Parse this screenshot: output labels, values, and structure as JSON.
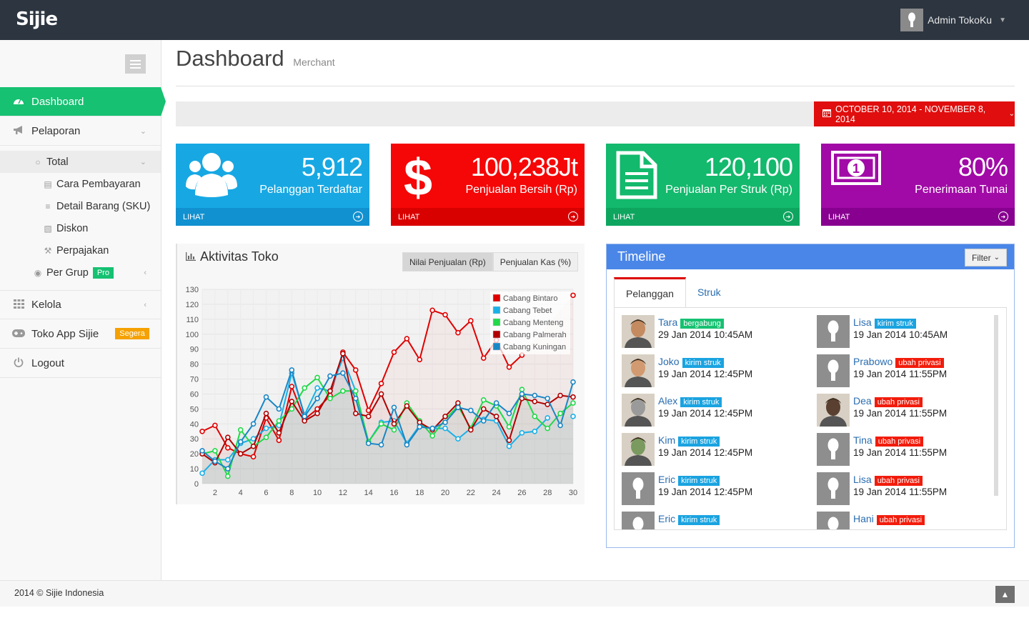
{
  "topbar": {
    "brand": "Sijie",
    "user_name": "Admin TokoKu"
  },
  "sidebar": {
    "items": [
      {
        "label": "Dashboard",
        "icon": "dashboard-icon"
      },
      {
        "label": "Pelaporan",
        "icon": "bullhorn-icon"
      },
      {
        "label": "Kelola",
        "icon": "grid-icon"
      },
      {
        "label": "Toko App Sijie",
        "icon": "gamepad-icon",
        "badge": "Segera"
      },
      {
        "label": "Logout",
        "icon": "power-icon"
      }
    ],
    "subitems": [
      {
        "label": "Total",
        "icon": "circle-icon"
      },
      {
        "label": "Cara Pembayaran",
        "icon": "credit-card-icon"
      },
      {
        "label": "Detail Barang (SKU)",
        "icon": "list-icon"
      },
      {
        "label": "Diskon",
        "icon": "gift-icon"
      },
      {
        "label": "Perpajakan",
        "icon": "gavel-icon"
      },
      {
        "label": "Per Grup",
        "icon": "map-marker-icon",
        "badge": "Pro"
      }
    ]
  },
  "page": {
    "title": "Dashboard",
    "subtitle": "Merchant"
  },
  "daterange": "OCTOBER 10, 2014 - NOVEMBER 8, 2014",
  "stats": [
    {
      "value": "5,912",
      "label": "Pelanggan Terdaftar",
      "link": "LIHAT",
      "color": "#17a8e3",
      "footer_color": "#1291d0"
    },
    {
      "value": "100,238Jt",
      "label": "Penjualan Bersih (Rp)",
      "link": "LIHAT",
      "color": "#f50707",
      "footer_color": "#d90000"
    },
    {
      "value": "120,100",
      "label": "Penjualan Per Struk (Rp)",
      "link": "LIHAT",
      "color": "#13b96c",
      "footer_color": "#0ea65f"
    },
    {
      "value": "80%",
      "label": "Penerimaan Tunai",
      "link": "LIHAT",
      "color": "#a10aa6",
      "footer_color": "#880090"
    }
  ],
  "chart_panel": {
    "title": "Aktivitas Toko",
    "segments": [
      "Nilai Penjualan (Rp)",
      "Penjualan Kas (%)"
    ]
  },
  "chart_data": {
    "type": "line",
    "x": [
      1,
      2,
      3,
      4,
      5,
      6,
      7,
      8,
      9,
      10,
      11,
      12,
      13,
      14,
      15,
      16,
      17,
      18,
      19,
      20,
      21,
      22,
      23,
      24,
      25,
      26,
      27,
      28,
      29,
      30
    ],
    "xticks": [
      2,
      4,
      6,
      8,
      10,
      12,
      14,
      16,
      18,
      20,
      22,
      24,
      26,
      28,
      30
    ],
    "ylim": [
      0,
      130
    ],
    "yticks": [
      0,
      10,
      20,
      30,
      40,
      50,
      60,
      70,
      80,
      90,
      100,
      110,
      120,
      130
    ],
    "legend_position": "top-right",
    "grid": true,
    "series": [
      {
        "name": "Cabang Bintaro",
        "color": "#e00000",
        "values": [
          35,
          39,
          24,
          20,
          18,
          44,
          29,
          65,
          43,
          50,
          59,
          88,
          76,
          49,
          67,
          88,
          97,
          83,
          116,
          113,
          101,
          109,
          84,
          96,
          78,
          86,
          null,
          null,
          null,
          126
        ]
      },
      {
        "name": "Cabang Tebet",
        "color": "#1ab0e8",
        "values": [
          7,
          16,
          16,
          27,
          30,
          37,
          39,
          74,
          46,
          64,
          62,
          84,
          62,
          28,
          41,
          42,
          27,
          39,
          37,
          37,
          30,
          37,
          43,
          42,
          25,
          34,
          35,
          44,
          null,
          45
        ]
      },
      {
        "name": "Cabang Menteng",
        "color": "#22d84a",
        "values": [
          20,
          22,
          5,
          36,
          25,
          31,
          42,
          50,
          64,
          71,
          57,
          62,
          62,
          28,
          40,
          36,
          54,
          42,
          32,
          43,
          52,
          37,
          56,
          52,
          38,
          63,
          45,
          37,
          47,
          54
        ]
      },
      {
        "name": "Cabang Palmerah",
        "color": "#b00000",
        "values": [
          20,
          14,
          31,
          20,
          25,
          47,
          34,
          55,
          42,
          47,
          62,
          87,
          47,
          45,
          60,
          40,
          52,
          41,
          36,
          45,
          54,
          36,
          50,
          45,
          29,
          57,
          55,
          53,
          59,
          58
        ]
      },
      {
        "name": "Cabang Kuningan",
        "color": "#1a86c4",
        "values": [
          22,
          15,
          10,
          28,
          40,
          58,
          50,
          76,
          45,
          57,
          72,
          74,
          57,
          27,
          26,
          51,
          26,
          38,
          37,
          41,
          51,
          49,
          42,
          54,
          47,
          60,
          59,
          57,
          39,
          68
        ]
      }
    ]
  },
  "timeline": {
    "title": "Timeline",
    "filter": "Filter",
    "tabs": [
      "Pelanggan",
      "Struk"
    ],
    "left": [
      {
        "name": "Tara",
        "tag": "bergabung",
        "tag_color": "#16c172",
        "date": "29 Jan 2014 10:45AM",
        "photo": true
      },
      {
        "name": "Joko",
        "tag": "kirim struk",
        "tag_color": "#1aa3e0",
        "date": "19 Jan 2014 12:45PM",
        "photo": true
      },
      {
        "name": "Alex",
        "tag": "kirim struk",
        "tag_color": "#1aa3e0",
        "date": "19 Jan 2014 12:45PM",
        "photo": true
      },
      {
        "name": "Kim",
        "tag": "kirim struk",
        "tag_color": "#1aa3e0",
        "date": "19 Jan 2014 12:45PM",
        "photo": true
      },
      {
        "name": "Eric",
        "tag": "kirim struk",
        "tag_color": "#1aa3e0",
        "date": "19 Jan 2014 12:45PM",
        "photo": false
      },
      {
        "name": "Eric",
        "tag": "kirim struk",
        "tag_color": "#1aa3e0",
        "date": "",
        "photo": false
      }
    ],
    "right": [
      {
        "name": "Lisa",
        "tag": "kirim struk",
        "tag_color": "#1aa3e0",
        "date": "19 Jan 2014 10:45AM",
        "photo": false
      },
      {
        "name": "Prabowo",
        "tag": "ubah privasi",
        "tag_color": "#f21c0c",
        "date": "19 Jan 2014 11:55PM",
        "photo": false
      },
      {
        "name": "Dea",
        "tag": "ubah privasi",
        "tag_color": "#f21c0c",
        "date": "19 Jan 2014 11:55PM",
        "photo": true
      },
      {
        "name": "Tina",
        "tag": "ubah privasi",
        "tag_color": "#f21c0c",
        "date": "19 Jan 2014 11:55PM",
        "photo": false
      },
      {
        "name": "Lisa",
        "tag": "ubah privasi",
        "tag_color": "#f21c0c",
        "date": "19 Jan 2014 11:55PM",
        "photo": false
      },
      {
        "name": "Hani",
        "tag": "ubah privasi",
        "tag_color": "#f21c0c",
        "date": "",
        "photo": false
      }
    ]
  },
  "footer": {
    "copyright": "2014 © Sijie Indonesia"
  }
}
